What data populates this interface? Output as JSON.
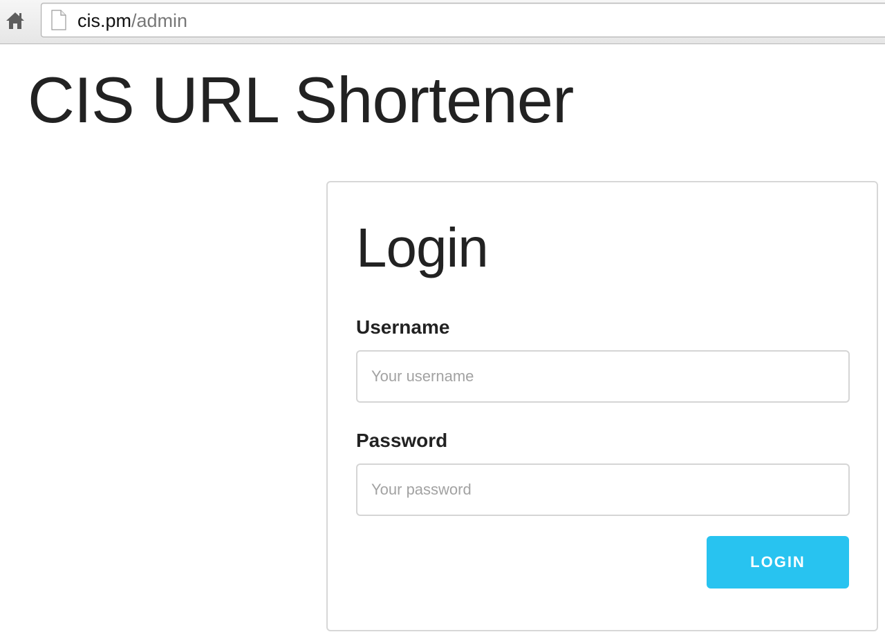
{
  "browser": {
    "home_icon": "home-icon",
    "page_icon": "document-icon",
    "url_host": "cis.pm",
    "url_path": "/admin"
  },
  "site": {
    "title": "CIS URL Shortener"
  },
  "login": {
    "heading": "Login",
    "username_label": "Username",
    "username_placeholder": "Your username",
    "username_value": "",
    "password_label": "Password",
    "password_placeholder": "Your password",
    "password_value": "",
    "button_label": "LOGIN"
  },
  "colors": {
    "accent": "#28c3f0",
    "text": "#222222",
    "border": "#d5d5d5"
  }
}
